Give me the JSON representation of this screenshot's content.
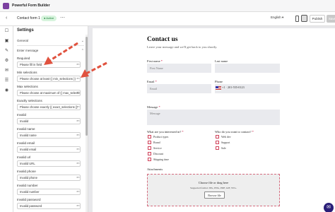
{
  "app": {
    "title": "Powerful Form Builder"
  },
  "toolbar": {
    "back_icon": "‹",
    "form_name": "Contact form 1",
    "status": "● Active",
    "more_icon": "⋯",
    "language": "English ▾",
    "publish_label": "Publish",
    "save_label": "Save"
  },
  "rail": {
    "icons": [
      "☐",
      "▣",
      "✎",
      "⚙",
      "✉",
      "☰",
      "◉"
    ]
  },
  "settings": {
    "title": "Settings",
    "general_label": "General",
    "enter_message_label": "Enter message",
    "fields": [
      {
        "label": "Required",
        "value": "Please fill in field"
      },
      {
        "label": "Min selections",
        "value": "Please choose at least {{ min_selections }}"
      },
      {
        "label": "Max selections",
        "value": "Please choose at maximum of {{ max_selections }}"
      },
      {
        "label": "Exactly selections",
        "value": "Please choose exactly {{ exact_selections }}"
      },
      {
        "label": "Invalid",
        "value": "Invalid"
      },
      {
        "label": "Invalid name",
        "value": "Invalid name"
      },
      {
        "label": "Invalid email",
        "value": "Invalid email"
      },
      {
        "label": "Invalid url",
        "value": "Invalid URL"
      },
      {
        "label": "Invalid phone",
        "value": "Invalid phone"
      },
      {
        "label": "Invalid number",
        "value": "Invalid number"
      },
      {
        "label": "Invalid password",
        "value": "Invalid password"
      }
    ],
    "lang_tag": "en"
  },
  "form": {
    "title": "Contact us",
    "subtitle": "Leave your message and we'll get back to you shortly.",
    "first_name_label": "First name",
    "first_name_placeholder": "First Name",
    "last_name_label": "Last name",
    "email_label": "Email",
    "email_placeholder": "Email",
    "phone_label": "Phone",
    "phone_code": "+1 · 201-555-0123",
    "message_label": "Message",
    "message_placeholder": "Message",
    "interest_label": "What are you interested in?",
    "interest_options": [
      "Product types",
      "Brand",
      "Service",
      "Discount",
      "Shipping time"
    ],
    "contact_label": "Who do you want to contact?",
    "contact_options": [
      "Web dev",
      "Support",
      "Sale"
    ],
    "attachments_label": "Attachments",
    "drop_title": "Choose file or drag here",
    "drop_sub": "Supported format: JPG, PNG, PDF, GIF, SVG.",
    "browse_label": "Browse file"
  },
  "help_icon": "✉",
  "colors": {
    "accent": "#d0425a",
    "arrow": "#e0523f",
    "brand": "#2a1e78"
  }
}
